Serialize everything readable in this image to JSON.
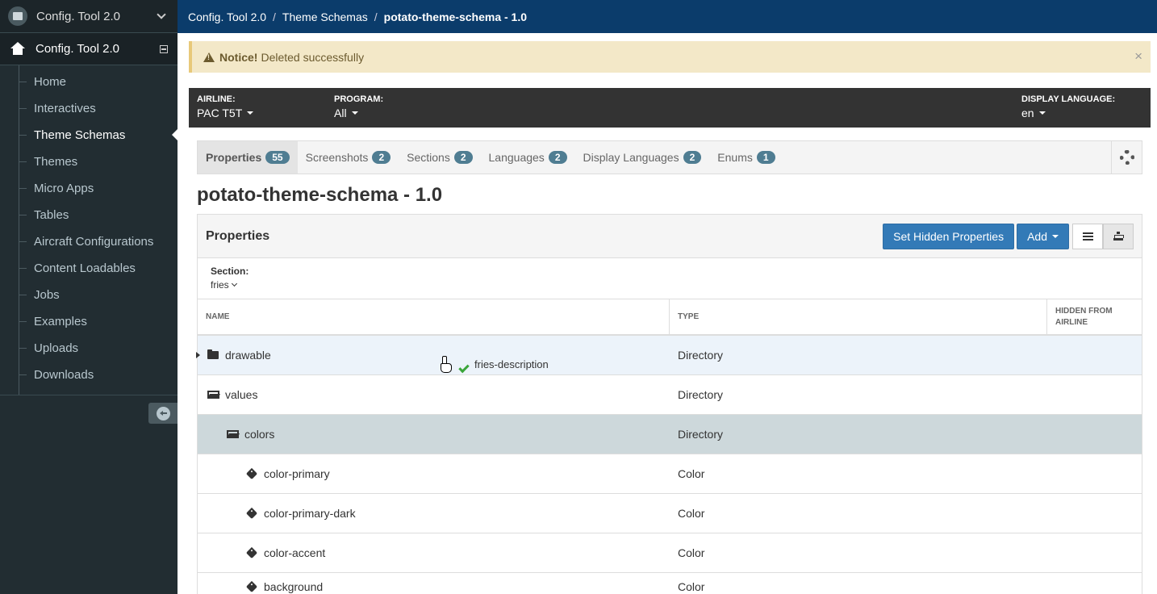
{
  "sidebar": {
    "app_title": "Config. Tool 2.0",
    "section_title": "Config. Tool 2.0",
    "items": [
      {
        "label": "Home"
      },
      {
        "label": "Interactives"
      },
      {
        "label": "Theme Schemas"
      },
      {
        "label": "Themes"
      },
      {
        "label": "Micro Apps"
      },
      {
        "label": "Tables"
      },
      {
        "label": "Aircraft Configurations"
      },
      {
        "label": "Content Loadables"
      },
      {
        "label": "Jobs"
      },
      {
        "label": "Examples"
      },
      {
        "label": "Uploads"
      },
      {
        "label": "Downloads"
      }
    ],
    "active_item": "Theme Schemas"
  },
  "breadcrumb": {
    "items": [
      "Config. Tool 2.0",
      "Theme Schemas"
    ],
    "current": "potato-theme-schema - 1.0",
    "separator": "/"
  },
  "alert": {
    "strong": "Notice!",
    "message": "Deleted successfully",
    "close": "×"
  },
  "filters": {
    "airline_label": "AIRLINE:",
    "airline_value": "PAC T5T",
    "program_label": "PROGRAM:",
    "program_value": "All",
    "display_language_label": "DISPLAY LANGUAGE:",
    "display_language_value": "en"
  },
  "tabs": [
    {
      "label": "Properties",
      "count": "55"
    },
    {
      "label": "Screenshots",
      "count": "2"
    },
    {
      "label": "Sections",
      "count": "2"
    },
    {
      "label": "Languages",
      "count": "2"
    },
    {
      "label": "Display Languages",
      "count": "2"
    },
    {
      "label": "Enums",
      "count": "1"
    }
  ],
  "page_title": "potato-theme-schema - 1.0",
  "panel": {
    "title": "Properties",
    "set_hidden_label": "Set Hidden Properties",
    "add_label": "Add",
    "section_label": "Section:",
    "section_value": "fries"
  },
  "table": {
    "headers": {
      "name": "NAME",
      "type": "TYPE",
      "hidden": "HIDDEN FROM AIRLINE"
    },
    "rows": [
      {
        "name": "drawable",
        "type": "Directory"
      },
      {
        "name": "values",
        "type": "Directory"
      },
      {
        "name": "colors",
        "type": "Directory"
      },
      {
        "name": "color-primary",
        "type": "Color"
      },
      {
        "name": "color-primary-dark",
        "type": "Color"
      },
      {
        "name": "color-accent",
        "type": "Color"
      },
      {
        "name": "background",
        "type": "Color"
      }
    ]
  },
  "drag_ghost": {
    "label": "fries-description"
  },
  "colors": {
    "sidebar_bg": "#222d32",
    "topbar_bg": "#0b3c6b",
    "primary": "#337ab7",
    "badge": "#4f7d92",
    "alert_bg": "#f3e8c8",
    "selected_row": "#cdd8db"
  }
}
